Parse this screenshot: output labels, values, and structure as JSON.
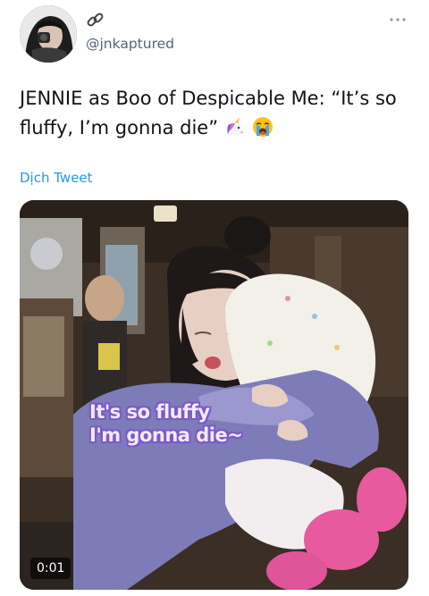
{
  "author": {
    "handle": "@jnkaptured",
    "avatar_icon": "profile-photo",
    "name_icon": "link-icon"
  },
  "menu": {
    "more_icon": "more-dots-icon"
  },
  "tweet": {
    "text": "JENNIE as Boo of Despicable Me: “It’s so fluffy, I’m gonna die”",
    "emojis": [
      "unicorn-icon",
      "loudly-crying-face-icon"
    ],
    "translate_label": "Dịch Tweet"
  },
  "media": {
    "type": "video",
    "caption_line1": "It's so fluffy",
    "caption_line2": "I'm gonna die~",
    "timestamp": "0:01"
  },
  "colors": {
    "link": "#1d9bf0",
    "secondary_text": "#536471",
    "caption_outline": "#7a5ac9"
  }
}
